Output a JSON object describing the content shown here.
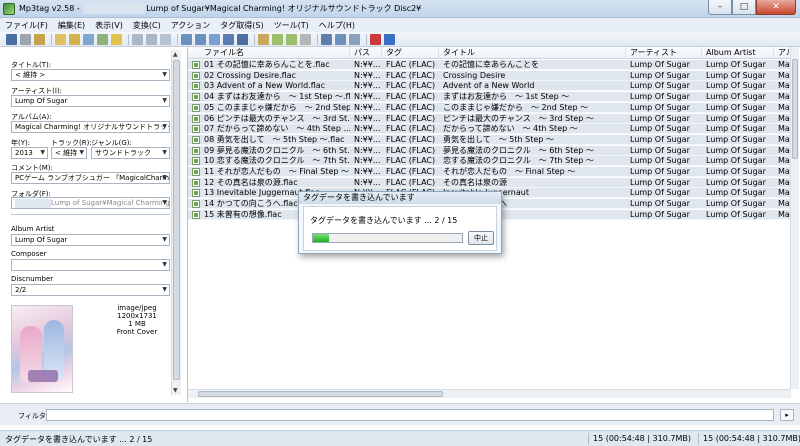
{
  "window": {
    "title_prefix": "Mp3tag v2.58  -  ",
    "title_suffix": "Lump of Sugar¥Magical Charming! オリジナルサウンドトラック Disc2¥",
    "min_label": "–",
    "max_label": "□",
    "close_label": "✕"
  },
  "menu": [
    "ファイル(F)",
    "編集(E)",
    "表示(V)",
    "変換(C)",
    "アクション",
    "タグ取得(S)",
    "ツール(T)",
    "ヘルプ(H)"
  ],
  "panel": {
    "title_label": "タイトル(T):",
    "title_value": "< 維持 >",
    "artist_label": "アーティスト(I):",
    "artist_value": "Lump Of Sugar",
    "album_label": "アルバム(A):",
    "album_value": "Magical Charming! オリジナルサウンドトラック Disc2",
    "year_label": "年(Y):",
    "year_value": "2013",
    "track_label": "トラック(R):",
    "track_value": "< 維持",
    "genre_label": "ジャンル(G):",
    "genre_value": "サウンドトラック",
    "comment_label": "コメント(M):",
    "comment_value": "PCゲーム ランブオブシュガー 『MagicalCharming!",
    "folder_label": "フォルダ(F):",
    "folder_value": "Lump of Sugar¥Magical Charming! オリ",
    "album_artist_label": "Album Artist",
    "album_artist_value": "Lump Of Sugar",
    "composer_label": "Composer",
    "composer_value": "",
    "discnumber_label": "Discnumber",
    "discnumber_value": "2/2",
    "cover_type": "image/jpeg",
    "cover_dims": "1200x1731",
    "cover_size": "1 MB",
    "cover_kind": "Front Cover"
  },
  "grid": {
    "columns": [
      "ファイル名",
      "パス",
      "タグ",
      "タイトル",
      "アーティスト",
      "Album Artist",
      "アル"
    ],
    "rows": [
      {
        "file": "01 その記憶に幸あらんことを.flac",
        "path": "N:¥¥...",
        "tag": "FLAC (FLAC)",
        "title": "その記憶に幸あらんことを",
        "artist": "Lump Of Sugar",
        "aartist": "Lump Of Sugar",
        "album": "Ma"
      },
      {
        "file": "02 Crossing Desire.flac",
        "path": "N:¥¥...",
        "tag": "FLAC (FLAC)",
        "title": "Crossing Desire",
        "artist": "Lump Of Sugar",
        "aartist": "Lump Of Sugar",
        "album": "Ma"
      },
      {
        "file": "03 Advent of a New World.flac",
        "path": "N:¥¥...",
        "tag": "FLAC (FLAC)",
        "title": "Advent of a New World",
        "artist": "Lump Of Sugar",
        "aartist": "Lump Of Sugar",
        "album": "Ma"
      },
      {
        "file": "04 まずはお友達から　～ 1st Step ～.flac",
        "path": "N:¥¥...",
        "tag": "FLAC (FLAC)",
        "title": "まずはお友達から　～ 1st Step ～",
        "artist": "Lump Of Sugar",
        "aartist": "Lump Of Sugar",
        "album": "Ma"
      },
      {
        "file": "05 このままじゃ嫌だから　～ 2nd Step...",
        "path": "N:¥¥...",
        "tag": "FLAC (FLAC)",
        "title": "このままじゃ嫌だから　～ 2nd Step ～",
        "artist": "Lump Of Sugar",
        "aartist": "Lump Of Sugar",
        "album": "Ma"
      },
      {
        "file": "06 ピンチは最大のチャンス　～ 3rd St...",
        "path": "N:¥¥...",
        "tag": "FLAC (FLAC)",
        "title": "ピンチは最大のチャンス　～ 3rd Step ～",
        "artist": "Lump Of Sugar",
        "aartist": "Lump Of Sugar",
        "album": "Ma"
      },
      {
        "file": "07 だからって諦めない　～ 4th Step ...",
        "path": "N:¥¥...",
        "tag": "FLAC (FLAC)",
        "title": "だからって諦めない　～ 4th Step ～",
        "artist": "Lump Of Sugar",
        "aartist": "Lump Of Sugar",
        "album": "Ma"
      },
      {
        "file": "08 勇気を出して　～ 5th Step ～.flac",
        "path": "N:¥¥...",
        "tag": "FLAC (FLAC)",
        "title": "勇気を出して　～ 5th Step ～",
        "artist": "Lump Of Sugar",
        "aartist": "Lump Of Sugar",
        "album": "Ma"
      },
      {
        "file": "09 夢見る魔法のクロニクル　～ 6th St...",
        "path": "N:¥¥...",
        "tag": "FLAC (FLAC)",
        "title": "夢見る魔法のクロニクル　～ 6th Step ～",
        "artist": "Lump Of Sugar",
        "aartist": "Lump Of Sugar",
        "album": "Ma"
      },
      {
        "file": "10 恋する魔法のクロニクル　～ 7th St...",
        "path": "N:¥¥...",
        "tag": "FLAC (FLAC)",
        "title": "恋する魔法のクロニクル　～ 7th Step ～",
        "artist": "Lump Of Sugar",
        "aartist": "Lump Of Sugar",
        "album": "Ma"
      },
      {
        "file": "11 それが恋人だもの　～ Final Step ～",
        "path": "N:¥¥...",
        "tag": "FLAC (FLAC)",
        "title": "それが恋人だもの　～ Final Step ～",
        "artist": "Lump Of Sugar",
        "aartist": "Lump Of Sugar",
        "album": "Ma"
      },
      {
        "file": "12 その真名は泉の源.flac",
        "path": "N:¥¥...",
        "tag": "FLAC (FLAC)",
        "title": "その真名は泉の源",
        "artist": "Lump Of Sugar",
        "aartist": "Lump Of Sugar",
        "album": "Ma"
      },
      {
        "file": "13 Inevitable Juggernaut.flac",
        "path": "N:¥¥...",
        "tag": "FLAC (FLAC)",
        "title": "Inevitable Juggernaut",
        "artist": "Lump Of Sugar",
        "aartist": "Lump Of Sugar",
        "album": "Ma"
      },
      {
        "file": "14 かつての向こうへ.flac",
        "path": "N:¥¥...",
        "tag": "FLAC (FLAC)",
        "title": "かつての向こうへ",
        "artist": "Lump Of Sugar",
        "aartist": "Lump Of Sugar",
        "album": "Ma"
      },
      {
        "file": "15 未曾有の想像.flac",
        "path": "N:¥¥...",
        "tag": "FLAC (FLAC)",
        "title": "未曾有の想像",
        "artist": "Lump Of Sugar",
        "aartist": "Lump Of Sugar",
        "album": "Ma"
      }
    ]
  },
  "filter": {
    "label": "フィルタ",
    "value": "",
    "button": "▸"
  },
  "status": {
    "left": "タグデータを書き込んでいます ... 2 / 15",
    "right1": "15 (00:54:48 | 310.7MB)",
    "right2": "15 (00:54:48 | 310.7MB)"
  },
  "dialog": {
    "title": "タグデータを書き込んでいます",
    "message": "タグデータを書き込んでいます ... 2 / 15",
    "progress": 0.11,
    "cancel": "中止"
  },
  "colors": {
    "row_bg": "#dfe6ee",
    "progress_green": "#20b020",
    "titlebar": "#c0d4ea"
  }
}
